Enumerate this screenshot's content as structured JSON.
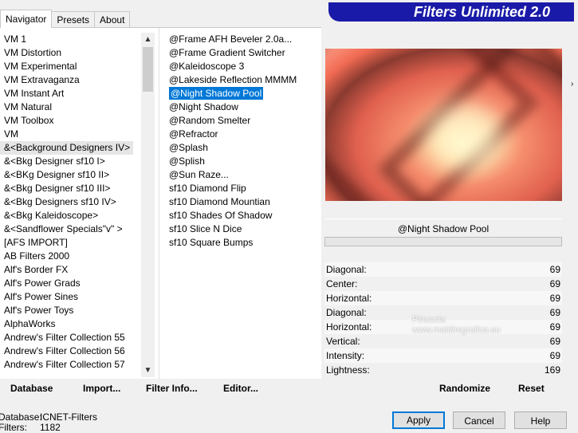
{
  "tabs": [
    {
      "label": "Navigator"
    },
    {
      "label": "Presets"
    },
    {
      "label": "About"
    }
  ],
  "banner_title": "Filters Unlimited 2.0",
  "categories": [
    "VM 1",
    "VM Distortion",
    "VM Experimental",
    "VM Extravaganza",
    "VM Instant Art",
    "VM Natural",
    "VM Toolbox",
    "VM",
    "&<Background Designers IV>",
    "&<Bkg Designer sf10 I>",
    "&<BKg Designer sf10 II>",
    "&<Bkg Designer sf10 III>",
    "&<Bkg Designers sf10 IV>",
    "&<Bkg Kaleidoscope>",
    "&<Sandflower Specials\"v\" >",
    "[AFS IMPORT]",
    "AB Filters 2000",
    "Alf's Border FX",
    "Alf's Power Grads",
    "Alf's Power Sines",
    "Alf's Power Toys",
    "AlphaWorks",
    "Andrew's Filter Collection 55",
    "Andrew's Filter Collection 56",
    "Andrew's Filter Collection 57"
  ],
  "highlighted_category_index": 8,
  "filters": [
    "@Frame AFH Beveler 2.0a...",
    "@Frame Gradient Switcher",
    "@Kaleidoscope 3",
    "@Lakeside Reflection MMMM",
    "@Night Shadow Pool",
    "@Night Shadow",
    "@Random Smelter",
    "@Refractor",
    "@Splash",
    "@Splish",
    "@Sun Raze...",
    "sf10 Diamond Flip",
    "sf10 Diamond Mountian",
    "sf10 Shades Of Shadow",
    "sf10 Slice N Dice",
    "sf10 Square Bumps"
  ],
  "selected_filter_index": 4,
  "selected_filter_name": "@Night Shadow Pool",
  "params": [
    {
      "label": "Diagonal:",
      "value": "69"
    },
    {
      "label": "Center:",
      "value": "69"
    },
    {
      "label": "Horizontal:",
      "value": "69"
    },
    {
      "label": "Diagonal:",
      "value": "69"
    },
    {
      "label": "Horizontal:",
      "value": "69"
    },
    {
      "label": "Vertical:",
      "value": "69"
    },
    {
      "label": "Intensity:",
      "value": "69"
    },
    {
      "label": "Lightness:",
      "value": "169"
    }
  ],
  "watermark": {
    "line1": "Pinuccia",
    "line2": "www.maldiregrafica.eu"
  },
  "buttons": {
    "database": "Database",
    "import": "Import...",
    "filter_info": "Filter Info...",
    "editor": "Editor...",
    "randomize": "Randomize",
    "reset": "Reset",
    "apply": "Apply",
    "cancel": "Cancel",
    "help": "Help"
  },
  "status": {
    "database_label": "Database:",
    "database_value": "ICNET-Filters",
    "filters_label": "Filters:",
    "filters_value": "1182"
  },
  "colors": {
    "accent": "#0078d7",
    "banner": "#1a1aa8"
  }
}
